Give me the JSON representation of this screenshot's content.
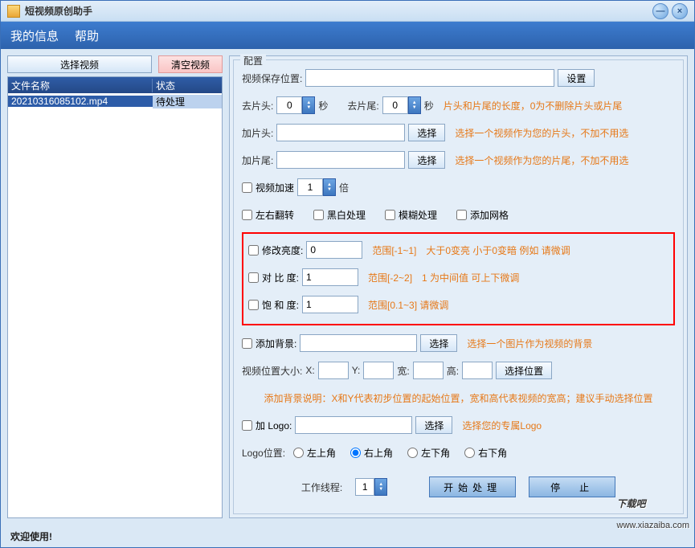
{
  "title": "短视频原创助手",
  "menu": {
    "myinfo": "我的信息",
    "help": "帮助"
  },
  "buttons": {
    "select_video": "选择视频",
    "clear_video": "清空视频",
    "set": "设置",
    "choose": "选择",
    "pos": "选择位置",
    "start": "开始处理",
    "stop": "停　止"
  },
  "table": {
    "col_name": "文件名称",
    "col_status": "状态",
    "rows": [
      {
        "name": "20210316085102.mp4",
        "status": "待处理"
      }
    ]
  },
  "config": {
    "legend": "配置",
    "save_path_label": "视频保存位置:",
    "save_path": "",
    "trim_head_label": "去片头:",
    "trim_head": "0",
    "sec": "秒",
    "trim_tail_label": "去片尾:",
    "trim_tail": "0",
    "trim_hint": "片头和片尾的长度，0为不删除片头或片尾",
    "add_head_label": "加片头:",
    "add_head": "",
    "add_head_hint": "选择一个视频作为您的片头，不加不用选",
    "add_tail_label": "加片尾:",
    "add_tail": "",
    "add_tail_hint": "选择一个视频作为您的片尾，不加不用选",
    "speed_label": "视频加速",
    "speed": "1",
    "times": "倍",
    "flip": "左右翻转",
    "bw": "黑白处理",
    "blur": "模糊处理",
    "grid": "添加网格",
    "brightness_label": "修改亮度:",
    "brightness": "0",
    "brightness_hint": "范围[-1~1]　大于0变亮 小于0变暗  例如 请微调",
    "contrast_label": "对 比  度:",
    "contrast": "1",
    "contrast_hint": "范围[-2~2]　1 为中间值  可上下微调",
    "saturate_label": "饱 和  度:",
    "saturate": "1",
    "saturate_hint": "范围[0.1~3]  请微调",
    "bg_label": "添加背景:",
    "bg": "",
    "bg_hint": "选择一个图片作为视频的背景",
    "pos_size_label": "视频位置大小:",
    "x_label": "X:",
    "x": "",
    "y_label": "Y:",
    "y": "",
    "w_label": "宽:",
    "w": "",
    "h_label": "高:",
    "h": "",
    "bg_note": "添加背景说明：X和Y代表初步位置的起始位置，宽和高代表视频的宽高；建议手动选择位置",
    "logo_label": "加 Logo:",
    "logo": "",
    "logo_hint": "选择您的专属Logo",
    "logo_pos_label": "Logo位置:",
    "lt": "左上角",
    "rt": "右上角",
    "lb": "左下角",
    "rb": "右下角",
    "threads_label": "工作线程:",
    "threads": "1"
  },
  "status": "欢迎使用!",
  "watermark": "下载吧",
  "watermark_url": "www.xiazaiba.com"
}
